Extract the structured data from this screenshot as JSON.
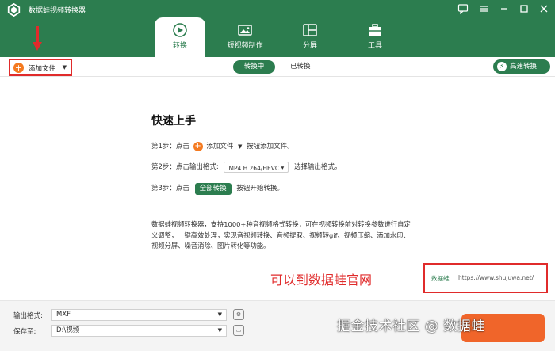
{
  "app": {
    "title": "数据蛙视频转换器"
  },
  "tabs": [
    {
      "label": "转换",
      "icon": "convert-icon"
    },
    {
      "label": "短视频制作",
      "icon": "video-maker-icon"
    },
    {
      "label": "分屏",
      "icon": "split-screen-icon"
    },
    {
      "label": "工具",
      "icon": "toolbox-icon"
    }
  ],
  "toolbar": {
    "add_file": "添加文件",
    "sub_tabs": [
      "转换中",
      "已转换"
    ],
    "fast_convert": "高速转换"
  },
  "guide": {
    "title": "快速上手",
    "step1_prefix": "第1步：点击",
    "step1_btn": "添加文件",
    "step1_suffix": "按钮添加文件。",
    "step2_prefix": "第2步：点击输出格式:",
    "step2_format": "MP4 H.264/HEVC",
    "step2_suffix": "选择输出格式。",
    "step3_prefix": "第3步：点击",
    "step3_btn": "全部转换",
    "step3_suffix": "按钮开始转换。",
    "description": "数据蛙视频转换器，支持1000+种音视频格式转换，可在视频转换前对转换参数进行自定义调整，一键高效处理，实现音视频转换、音频提取、视频转gif、视频压缩、添加水印、视频分屏、噪音消除、图片转化等功能。"
  },
  "annotation": {
    "red_text": "可以到数据蛙官网",
    "brand": "数据蛙",
    "url": "https://www.shujuwa.net/"
  },
  "bottom": {
    "output_format_label": "输出格式:",
    "output_format_value": "MXF",
    "save_to_label": "保存至:",
    "save_to_value": "D:\\视频"
  },
  "watermark": "掘金技术社区 @ 数据蛙",
  "colors": {
    "primary": "#2c7d4f",
    "accent": "#f47a20",
    "annotation": "#e02b2b",
    "convert_button": "#f0652a"
  }
}
